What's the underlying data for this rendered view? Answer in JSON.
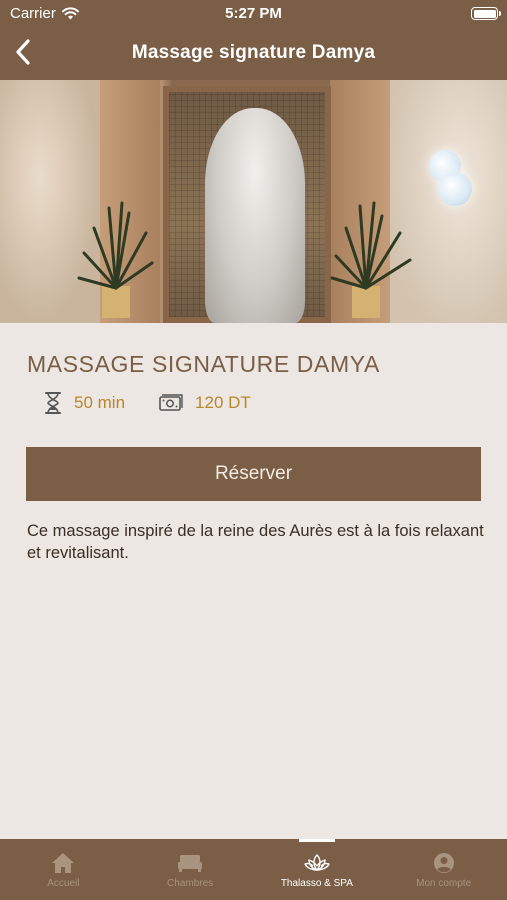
{
  "status_bar": {
    "carrier": "Carrier",
    "time": "5:27 PM",
    "wifi_icon": "wifi-icon",
    "battery_icon": "battery-icon"
  },
  "nav": {
    "back_icon": "chevron-left-icon",
    "title": "Massage signature Damya"
  },
  "hero": {
    "image": "spa-interior-photo"
  },
  "treatment": {
    "name": "MASSAGE SIGNATURE DAMYA",
    "duration": "50 min",
    "duration_icon": "hourglass-icon",
    "price": "120 DT",
    "price_icon": "money-icon",
    "reserve_label": "Réserver",
    "description": "Ce massage inspiré de la reine des Aurès est à la fois relaxant et revitalisant."
  },
  "tabbar": {
    "tabs": [
      {
        "label": "Accueil",
        "icon": "home-icon",
        "active": false
      },
      {
        "label": "Chambres",
        "icon": "bed-icon",
        "active": false
      },
      {
        "label": "Thalasso & SPA",
        "icon": "lotus-icon",
        "active": true
      },
      {
        "label": "Mon compte",
        "icon": "user-icon",
        "active": false
      }
    ]
  },
  "colors": {
    "brand": "#7a5e45",
    "background": "#ece7e3",
    "accent": "#b8862b"
  }
}
